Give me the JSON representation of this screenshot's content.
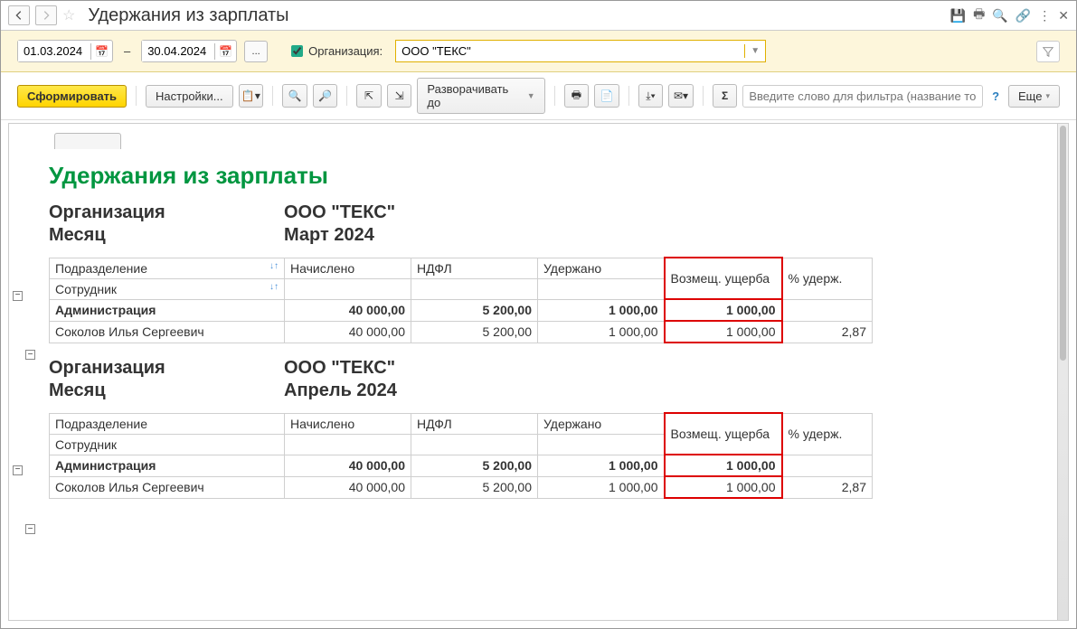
{
  "header": {
    "title": "Удержания из зарплаты"
  },
  "filter": {
    "date_from": "01.03.2024",
    "date_to": "30.04.2024",
    "ellipsis": "...",
    "org_checkbox": true,
    "org_label": "Организация:",
    "org_value": "ООО \"ТЕКС\""
  },
  "toolbar": {
    "generate": "Сформировать",
    "settings": "Настройки...",
    "expand": "Разворачивать до",
    "more": "Еще",
    "search_placeholder": "Введите слово для фильтра (название това..."
  },
  "report": {
    "title": "Удержания из зарплаты",
    "meta_labels": {
      "org": "Организация",
      "month": "Месяц"
    },
    "columns": {
      "dept": "Подразделение",
      "employee": "Сотрудник",
      "accrued": "Начислено",
      "ndfl": "НДФЛ",
      "withheld": "Удержано",
      "damage": "Возмещ. ущерба",
      "percent": "% удерж."
    },
    "months": [
      {
        "org_value": "ООО \"ТЕКС\"",
        "month_value": "Март 2024",
        "show_sort": true,
        "rows": [
          {
            "bold": true,
            "dept": "Администрация",
            "accrued": "40 000,00",
            "ndfl": "5 200,00",
            "withheld": "1 000,00",
            "damage": "1 000,00",
            "percent": ""
          },
          {
            "bold": false,
            "dept": "Соколов Илья Сергеевич",
            "accrued": "40 000,00",
            "ndfl": "5 200,00",
            "withheld": "1 000,00",
            "damage": "1 000,00",
            "percent": "2,87"
          }
        ]
      },
      {
        "org_value": "ООО \"ТЕКС\"",
        "month_value": "Апрель 2024",
        "show_sort": false,
        "rows": [
          {
            "bold": true,
            "dept": "Администрация",
            "accrued": "40 000,00",
            "ndfl": "5 200,00",
            "withheld": "1 000,00",
            "damage": "1 000,00",
            "percent": ""
          },
          {
            "bold": false,
            "dept": "Соколов Илья Сергеевич",
            "accrued": "40 000,00",
            "ndfl": "5 200,00",
            "withheld": "1 000,00",
            "damage": "1 000,00",
            "percent": "2,87"
          }
        ]
      }
    ]
  }
}
